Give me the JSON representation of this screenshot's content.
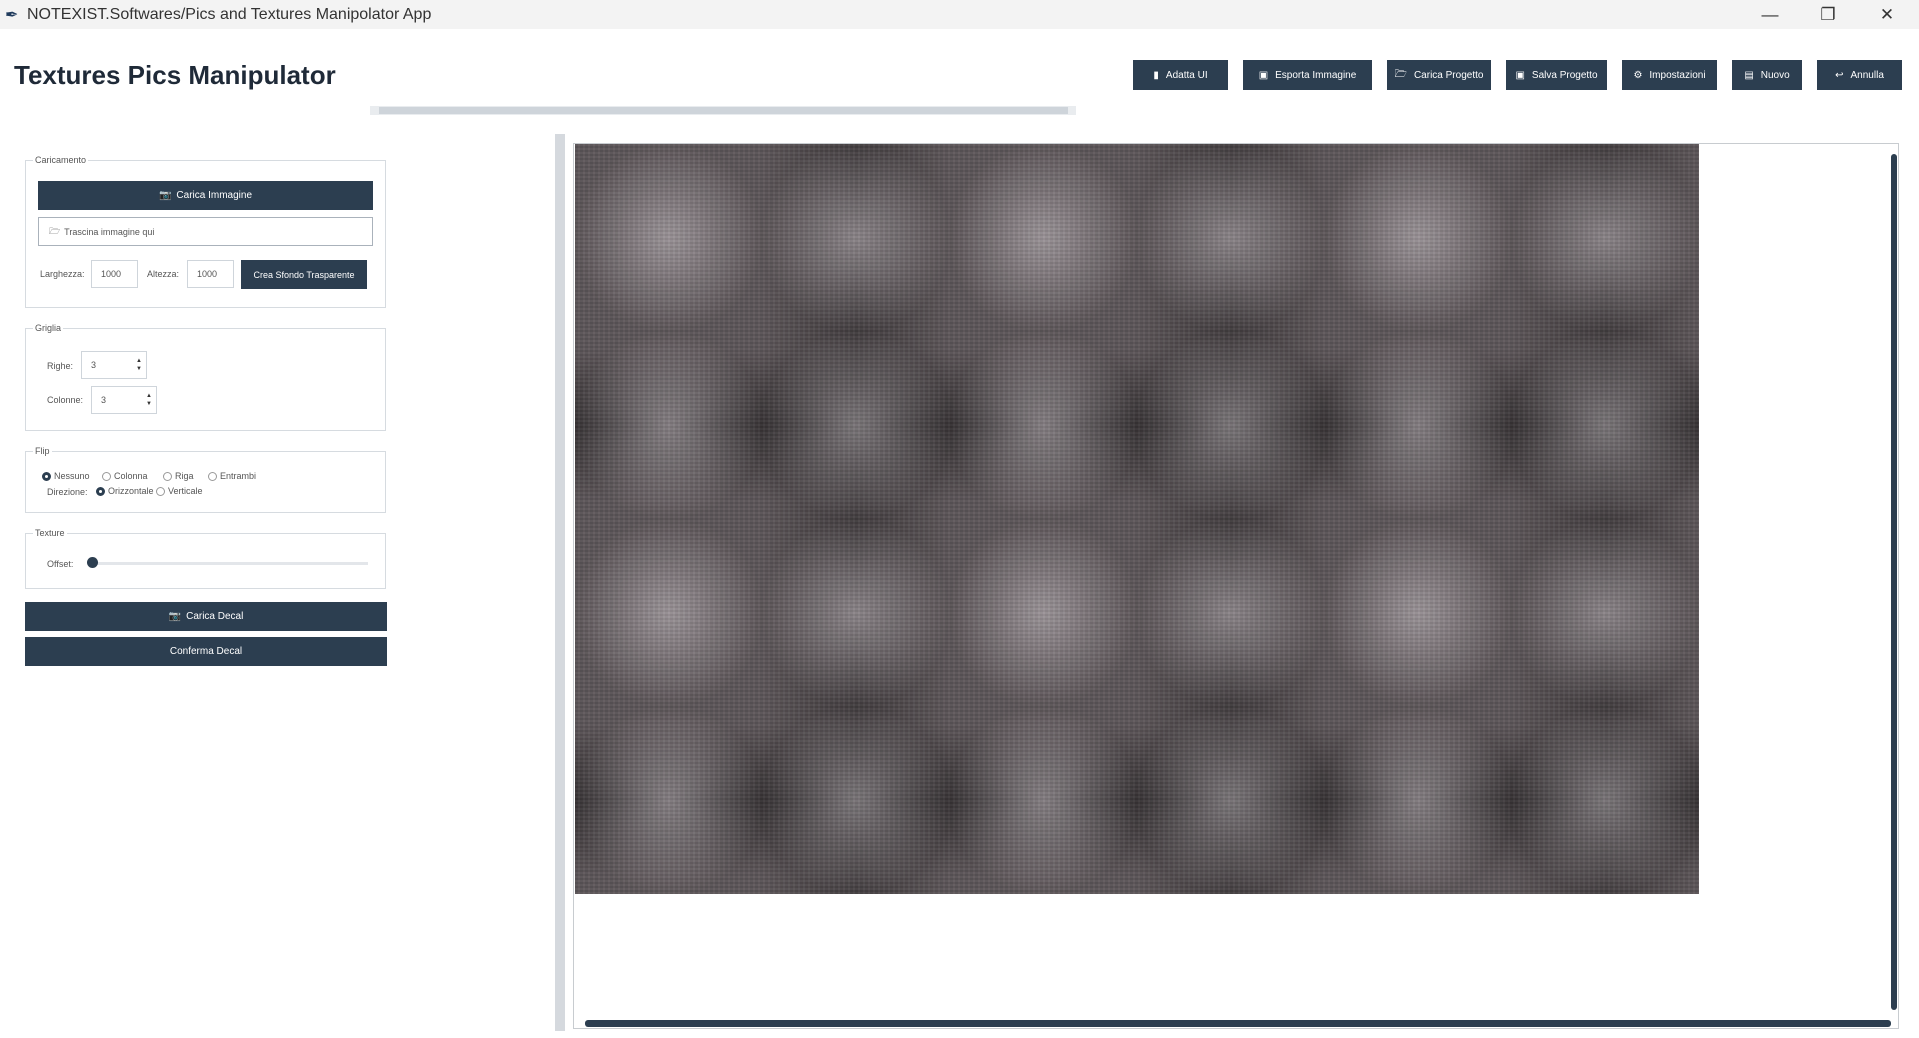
{
  "window": {
    "title": "NOTEXIST.Softwares/Pics and Textures Manipolator App",
    "icon": "feather-icon",
    "controls": {
      "minimize": "—",
      "maximize": "❐",
      "close": "✕"
    }
  },
  "header": {
    "title": "Textures Pics Manipulator",
    "toolbar": [
      {
        "icon": "bookmark-icon",
        "glyph": "▮",
        "label": "Adatta UI"
      },
      {
        "icon": "image-export-icon",
        "glyph": "▣",
        "label": "Esporta Immagine"
      },
      {
        "icon": "folder-open-icon",
        "glyph": "🗁",
        "label": "Carica Progetto"
      },
      {
        "icon": "save-icon",
        "glyph": "▣",
        "label": "Salva Progetto"
      },
      {
        "icon": "gear-icon",
        "glyph": "⚙",
        "label": "Impostazioni"
      },
      {
        "icon": "new-file-icon",
        "glyph": "▤",
        "label": "Nuovo"
      },
      {
        "icon": "undo-icon",
        "glyph": "↩",
        "label": "Annulla"
      }
    ]
  },
  "caricamento": {
    "label": "Caricamento",
    "load_button": "Carica Immagine",
    "load_icon_glyph": "📷",
    "drop_icon_glyph": "🗁",
    "drop_text": "Trascina immagine qui",
    "width_label": "Larghezza:",
    "width_value": "1000",
    "height_label": "Altezza:",
    "height_value": "1000",
    "transparent_button": "Crea Sfondo Trasparente"
  },
  "griglia": {
    "label": "Griglia",
    "rows_label": "Righe:",
    "rows_value": "3",
    "cols_label": "Colonne:",
    "cols_value": "3"
  },
  "flip": {
    "label": "Flip",
    "options": [
      "Nessuno",
      "Colonna",
      "Riga",
      "Entrambi"
    ],
    "selected": "Nessuno",
    "direction_label": "Direzione:",
    "directions": [
      "Orizzontale",
      "Verticale"
    ],
    "direction_selected": "Orizzontale"
  },
  "texture": {
    "label": "Texture",
    "offset_label": "Offset:",
    "offset_value": 0
  },
  "decal": {
    "load_button": "Carica Decal",
    "load_icon_glyph": "📷",
    "confirm_button": "Conferma Decal"
  },
  "colors": {
    "accent": "#2c3e50",
    "background": "#ffffff"
  }
}
